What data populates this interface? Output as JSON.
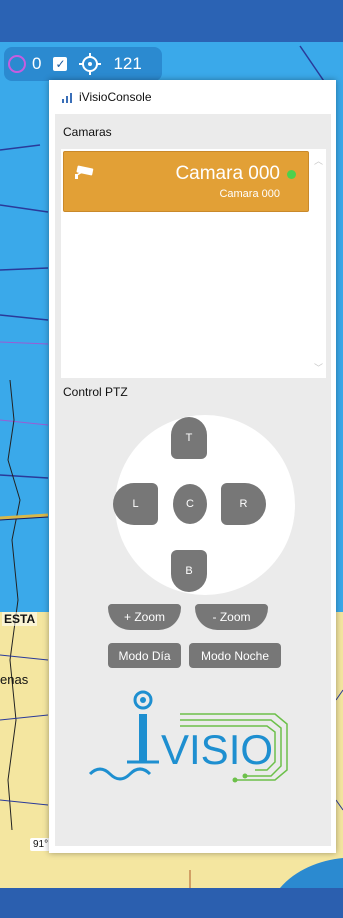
{
  "map": {
    "labels": {
      "esta": "ESTA",
      "enas": "enas",
      "deg": "91°"
    }
  },
  "map_toolbar": {
    "count_a": "0",
    "count_b": "121",
    "check_mark": "✓"
  },
  "window": {
    "title": "iVisioConsole"
  },
  "cameras": {
    "label": "Camaras",
    "items": [
      {
        "name": "Camara 000",
        "subtitle": "Camara 000"
      }
    ]
  },
  "ptz": {
    "label": "Control PTZ",
    "buttons": {
      "top": "T",
      "left": "L",
      "center": "C",
      "right": "R",
      "bottom": "B"
    },
    "zoom_in": "+ Zoom",
    "zoom_out": "- Zoom",
    "mode_day": "Modo Día",
    "mode_night": "Modo Noche"
  },
  "logo": {
    "text": "VISIO"
  },
  "colors": {
    "camera_selected": "#e2a036",
    "status_online": "#4cd14c",
    "ptz_button": "#777777",
    "logo_blue": "#1e8fd0",
    "logo_green": "#6cc04a"
  },
  "icons": [
    "ring-icon",
    "checkbox-icon",
    "target-icon",
    "app-icon",
    "security-camera-icon",
    "scroll-up-icon",
    "scroll-down-icon"
  ]
}
